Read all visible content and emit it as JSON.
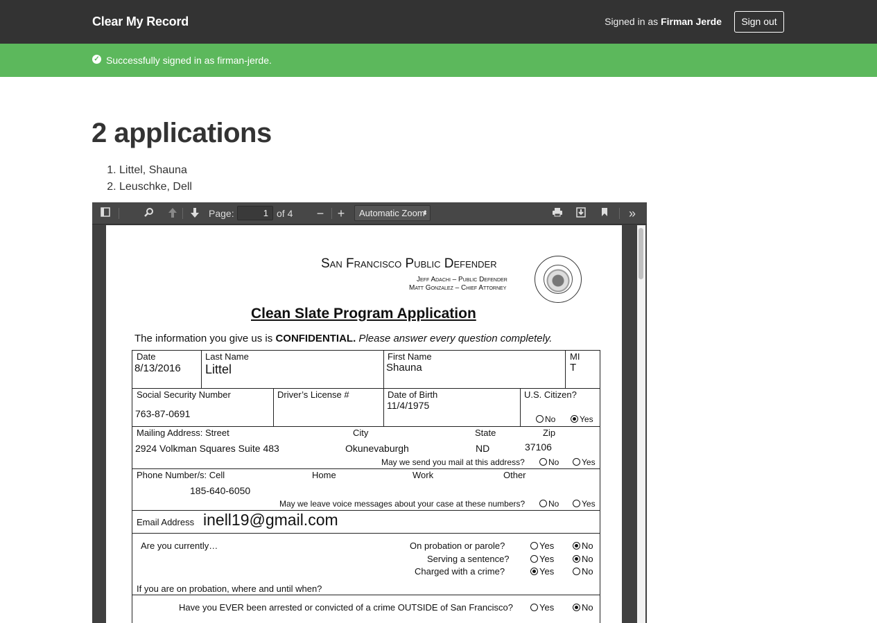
{
  "nav": {
    "brand": "Clear My Record",
    "signed_in_prefix": "Signed in as ",
    "signed_in_name": "Firman Jerde",
    "sign_out_label": "Sign out"
  },
  "flash": {
    "icon": "check-circle-icon",
    "message": "Successfully signed in as firman-jerde."
  },
  "main": {
    "heading": "2 applications",
    "applications": [
      "Littel, Shauna",
      "Leuschke, Dell"
    ]
  },
  "viewer": {
    "page_label": "Page:",
    "page_value": "1",
    "page_total": "of 4",
    "zoom_value": "Automatic Zoom",
    "zoom_out": "−",
    "zoom_in": "+"
  },
  "document": {
    "org_title": "San Francisco Public Defender",
    "line1": "Jeff Adachi – Public Defender",
    "line2": "Matt Gonzalez – Chief Attorney",
    "form_title": "Clean Slate Program Application",
    "intro_a": "The information you give us is ",
    "intro_b": "CONFIDENTIAL.",
    "intro_c": " Please answer every question completely.",
    "date_label": "Date",
    "date_value": "8/13/2016",
    "last_label": "Last Name",
    "last_value": "Littel",
    "first_label": "First Name",
    "first_value": "Shauna",
    "mi_label": "MI",
    "mi_value": "T",
    "ssn_label": "Social Security Number",
    "ssn_value": "763-87-0691",
    "dl_label": "Driver’s License #",
    "dob_label": "Date of Birth",
    "dob_value": "11/4/1975",
    "citizen_label": "U.S. Citizen?",
    "citizen_no": "No",
    "citizen_yes": "Yes",
    "addr_label": "Mailing Address:  Street",
    "city_label": "City",
    "state_label": "State",
    "zip_label": "Zip",
    "street_value": "2924 Volkman Squares Suite 483",
    "city_value": "Okunevaburgh",
    "state_value": "ND",
    "zip_value": "37106",
    "mail_q": "May we send you mail at this address?",
    "mail_no": "No",
    "mail_yes": "Yes",
    "phone_label": "Phone Number/s:  Cell",
    "home_label": "Home",
    "work_label": "Work",
    "other_label": "Other",
    "cell_value": "185-640-6050",
    "voice_q": "May we leave voice messages about your case at these numbers?",
    "voice_no": "No",
    "voice_yes": "Yes",
    "email_label": "Email Address",
    "email_value": "inell19@gmail.com",
    "currently_label": "Are you currently…",
    "probation_q": "On probation or parole?",
    "serving_q": "Serving a sentence?",
    "charged_q": "Charged with a crime?",
    "yes": "Yes",
    "no": "No",
    "probation_where": "If you are on probation, where and until when?",
    "outside_q": "Have you EVER been arrested or convicted of a crime OUTSIDE of San Francisco?"
  }
}
